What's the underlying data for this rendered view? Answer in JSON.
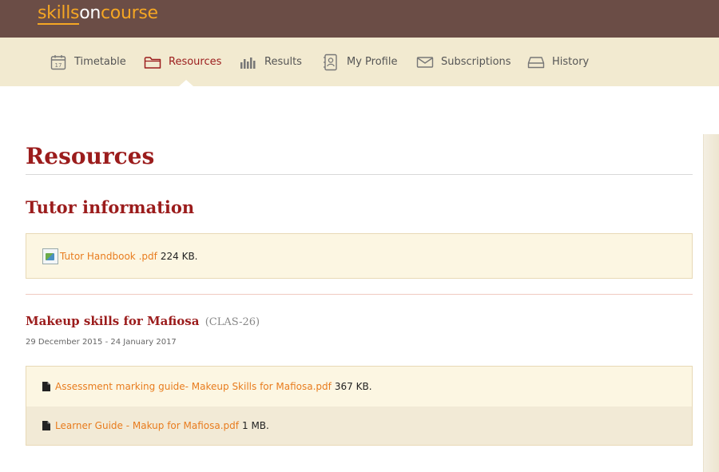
{
  "brand": {
    "part1": "skills",
    "part2": "on",
    "part3": "course"
  },
  "nav": {
    "items": [
      {
        "label": "Timetable",
        "icon": "calendar-icon"
      },
      {
        "label": "Resources",
        "icon": "folder-icon"
      },
      {
        "label": "Results",
        "icon": "bar-chart-icon"
      },
      {
        "label": "My Profile",
        "icon": "profile-icon"
      },
      {
        "label": "Subscriptions",
        "icon": "envelope-icon"
      },
      {
        "label": "History",
        "icon": "archive-icon"
      }
    ],
    "active": "Resources"
  },
  "page": {
    "title": "Resources"
  },
  "tutor": {
    "title": "Tutor information",
    "files": [
      {
        "name": "Tutor Handbook .pdf",
        "size": "224 KB."
      }
    ]
  },
  "course": {
    "title": "Makeup skills for Mafiosa",
    "code": "(CLAS-26)",
    "dates": "29 December 2015 - 24 January 2017",
    "files": [
      {
        "name": "Assessment marking guide- Makeup Skills for Mafiosa.pdf",
        "size": "367 KB."
      },
      {
        "name": "Learner Guide - Makup for Mafiosa.pdf",
        "size": "1 MB."
      }
    ]
  },
  "colors": {
    "header_bg": "#6b4d46",
    "nav_bg": "#f2ead0",
    "accent": "#9b1c1c",
    "link": "#e87c1e",
    "brand": "#f5a623"
  }
}
